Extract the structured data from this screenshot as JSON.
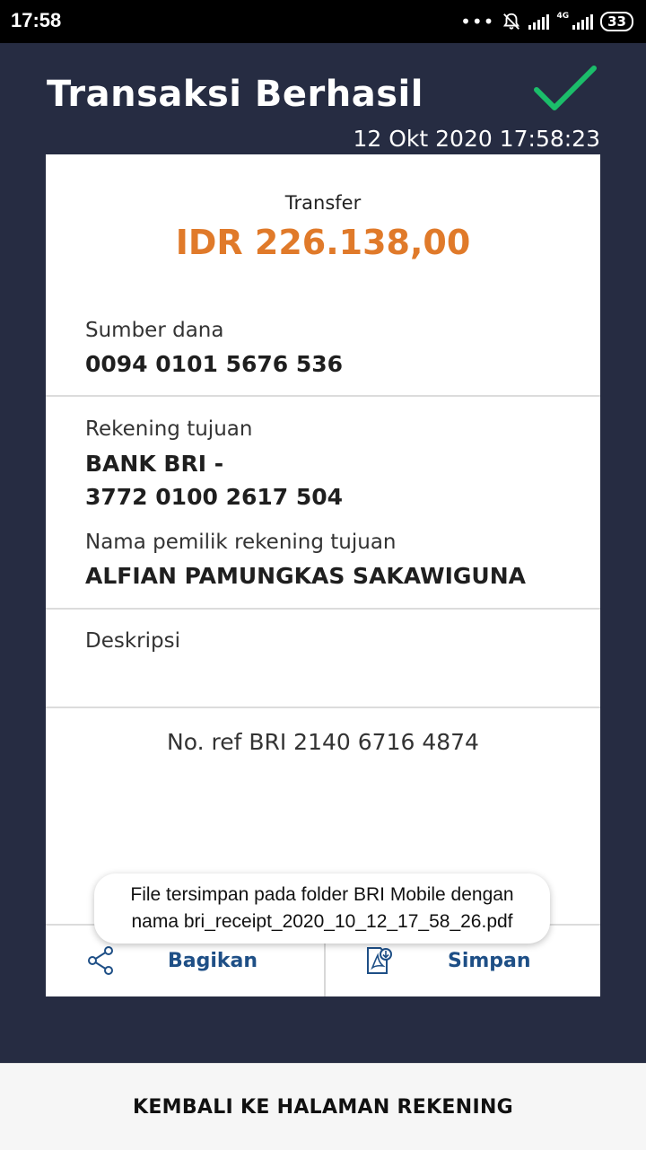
{
  "status_bar": {
    "time": "17:58",
    "network": "4G",
    "battery": "33",
    "icons": [
      "more-dots-icon",
      "notifications-off-icon",
      "signal-icon",
      "signal-icon",
      "battery-icon"
    ]
  },
  "header": {
    "title": "Transaksi Berhasil",
    "datetime": "12 Okt 2020 17:58:23",
    "success_icon": "checkmark-icon",
    "accent_color": "#1bbd6a"
  },
  "receipt": {
    "type_label": "Transfer",
    "amount": "IDR 226.138,00",
    "amount_color": "#e07a2a",
    "source_label": "Sumber dana",
    "source_value": "0094 0101 5676 536",
    "dest_label": "Rekening tujuan",
    "dest_bank": "BANK BRI -",
    "dest_account": "3772 0100 2617 504",
    "owner_label": "Nama pemilik rekening tujuan",
    "owner_value": "ALFIAN PAMUNGKAS SAKAWIGUNA",
    "description_label": "Deskripsi",
    "ref": "No. ref BRI 2140 6716 4874"
  },
  "actions": {
    "share_label": "Bagikan",
    "share_icon": "share-icon",
    "save_label": "Simpan",
    "save_icon": "pdf-download-icon"
  },
  "toast": {
    "line1": "File tersimpan pada folder BRI Mobile dengan",
    "line2": "nama bri_receipt_2020_10_12_17_58_26.pdf"
  },
  "footer": {
    "back_label": "KEMBALI KE HALAMAN REKENING"
  }
}
